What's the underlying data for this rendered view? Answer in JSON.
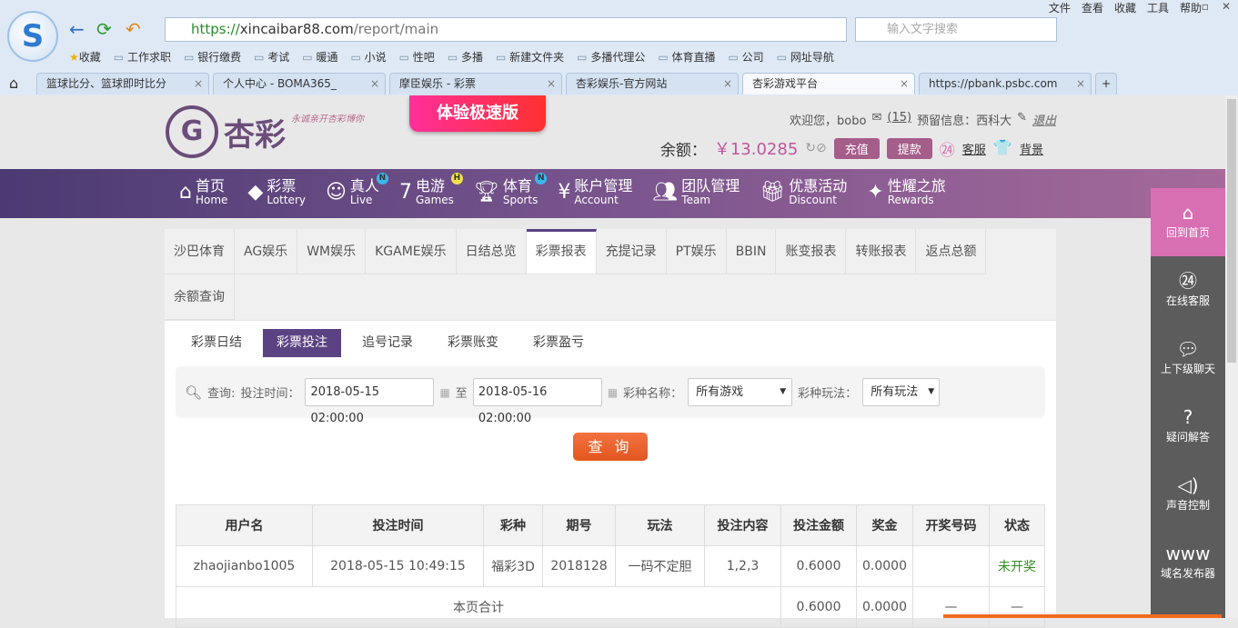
{
  "browser": {
    "menu": [
      "文件",
      "查看",
      "收藏",
      "工具",
      "帮助"
    ],
    "url_scheme": "https://",
    "url_domain": "xincaibar88.com",
    "url_path": "/report/main",
    "search_placeholder": "输入文字搜索",
    "bookmarks": [
      "收藏",
      "工作求职",
      "银行缴费",
      "考试",
      "暖通",
      "小说",
      "性吧",
      "多播",
      "新建文件夹",
      "多播代理公",
      "体育直播",
      "公司",
      "网址导航"
    ],
    "tabs": [
      "篮球比分、篮球即时比分",
      "个人中心 - BOMA365_",
      "摩臣娱乐 - 彩票",
      "杏彩娱乐-官方网站",
      "杏彩游戏平台",
      "https://pbank.psbc.com"
    ]
  },
  "header": {
    "brand": "杏彩",
    "slogan": "永诚亲开杏彩博你",
    "promo": "体验极速版",
    "welcome": "欢迎您，bobo",
    "messages": "(15)",
    "reserved_label": "预留信息：西科大",
    "logout": "退出",
    "balance_label": "余额：",
    "balance": "￥13.0285",
    "deposit": "充值",
    "withdraw": "提款",
    "service": "客服",
    "background": "背景"
  },
  "nav": [
    {
      "zh": "首页",
      "en": "Home",
      "icon": "home-icon"
    },
    {
      "zh": "彩票",
      "en": "Lottery",
      "icon": "lottery-icon"
    },
    {
      "zh": "真人",
      "en": "Live",
      "icon": "live-icon",
      "badge": "N"
    },
    {
      "zh": "电游",
      "en": "Games",
      "icon": "games-icon",
      "badge": "H"
    },
    {
      "zh": "体育",
      "en": "Sports",
      "icon": "trophy-icon",
      "badge": "N"
    },
    {
      "zh": "账户管理",
      "en": "Account",
      "icon": "yen-icon"
    },
    {
      "zh": "团队管理",
      "en": "Team",
      "icon": "team-icon"
    },
    {
      "zh": "优惠活动",
      "en": "Discount",
      "icon": "gift-icon"
    },
    {
      "zh": "性耀之旅",
      "en": "Rewards",
      "icon": "rewards-icon"
    }
  ],
  "report_tabs": [
    "沙巴体育",
    "AG娱乐",
    "WM娱乐",
    "KGAME娱乐",
    "日结总览",
    "彩票报表",
    "充提记录",
    "PT娱乐",
    "BBIN",
    "账变报表",
    "转账报表",
    "返点总额",
    "余额查询"
  ],
  "active_report_tab": "彩票报表",
  "sub_tabs": [
    "彩票日结",
    "彩票投注",
    "追号记录",
    "彩票账变",
    "彩票盈亏"
  ],
  "active_sub_tab": "彩票投注",
  "filter": {
    "query_label": "查询:",
    "time_label": "投注时间：",
    "start": "2018-05-15 02:00:00",
    "to": "至",
    "end": "2018-05-16 02:00:00",
    "game_label": "彩种名称：",
    "game": "所有游戏",
    "play_label": "彩种玩法：",
    "play": "所有玩法",
    "submit": "查 询"
  },
  "table": {
    "headers": [
      "用户名",
      "投注时间",
      "彩种",
      "期号",
      "玩法",
      "投注内容",
      "投注金额",
      "奖金",
      "开奖号码",
      "状态"
    ],
    "rows": [
      [
        "zhaojianbo1005",
        "2018-05-15 10:49:15",
        "福彩3D",
        "2018128",
        "一码不定胆",
        "1,2,3",
        "0.6000",
        "0.0000",
        "",
        "未开奖"
      ]
    ],
    "total": {
      "label": "本页合计",
      "amount": "0.6000",
      "bonus": "0.0000",
      "numbers": "—",
      "status": "—"
    }
  },
  "sidebar": [
    "回到首页",
    "在线客服",
    "上下级聊天",
    "疑问解答",
    "声音控制",
    "域名发布器"
  ],
  "colors": {
    "nav_start": "#4b3a73",
    "accent": "#5b4283",
    "pink": "#d86fb3",
    "orange": "#e4561f",
    "balance": "#c0569e"
  }
}
